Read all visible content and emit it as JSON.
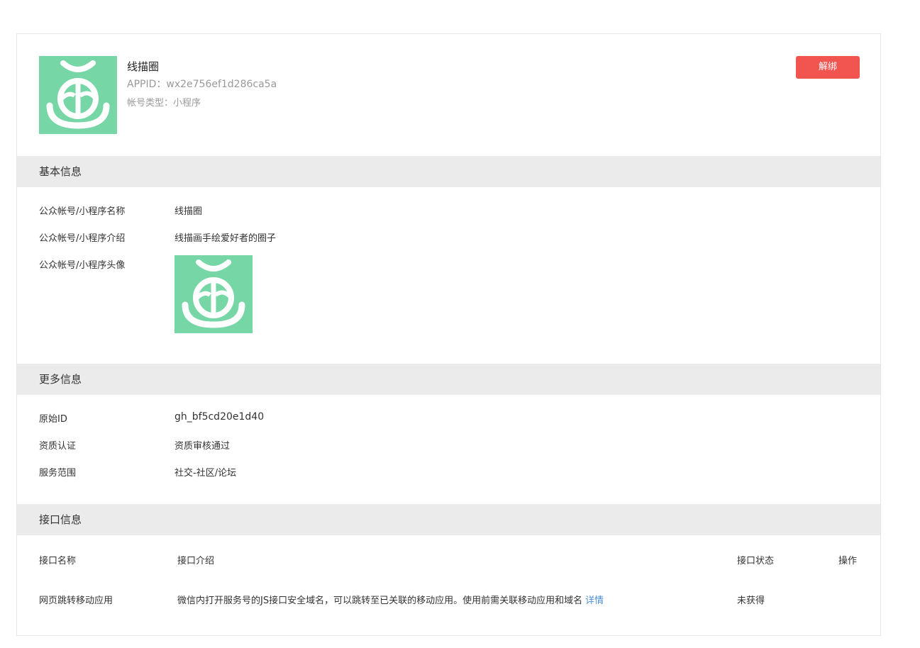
{
  "profile": {
    "name": "线描圈",
    "appid": "APPID：wx2e756ef1d286ca5a",
    "account_type": "帐号类型：小程序",
    "unbind_label": "解绑"
  },
  "basic_info": {
    "title": "基本信息",
    "rows": [
      {
        "label": "公众帐号/小程序名称",
        "value": "线描圈"
      },
      {
        "label": "公众帐号/小程序介绍",
        "value": "线描画手绘爱好者的圈子"
      },
      {
        "label": "公众帐号/小程序头像"
      }
    ]
  },
  "more_info": {
    "title": "更多信息",
    "rows": [
      {
        "label": "原始ID",
        "value": "gh_bf5cd20e1d40"
      },
      {
        "label": "资质认证",
        "value": "资质审核通过"
      },
      {
        "label": "服务范围",
        "value": "社交-社区/论坛"
      }
    ]
  },
  "api_info": {
    "title": "接口信息",
    "columns": [
      "接口名称",
      "接口介绍",
      "接口状态",
      "操作"
    ],
    "rows": [
      {
        "name": "网页跳转移动应用",
        "description": "微信内打开服务号的JS接口安全域名，可以跳转至已关联的移动应用。使用前需关联移动应用和域名",
        "link": "详情",
        "status": "未获得",
        "action": ""
      }
    ]
  },
  "colors": {
    "avatar_bg": "#77d6a6",
    "unbind_button": "#f25450",
    "section_header_bg": "#ebebeb",
    "link": "#4a90d9"
  },
  "icons": {
    "app_logo": "app-logo-icon"
  }
}
